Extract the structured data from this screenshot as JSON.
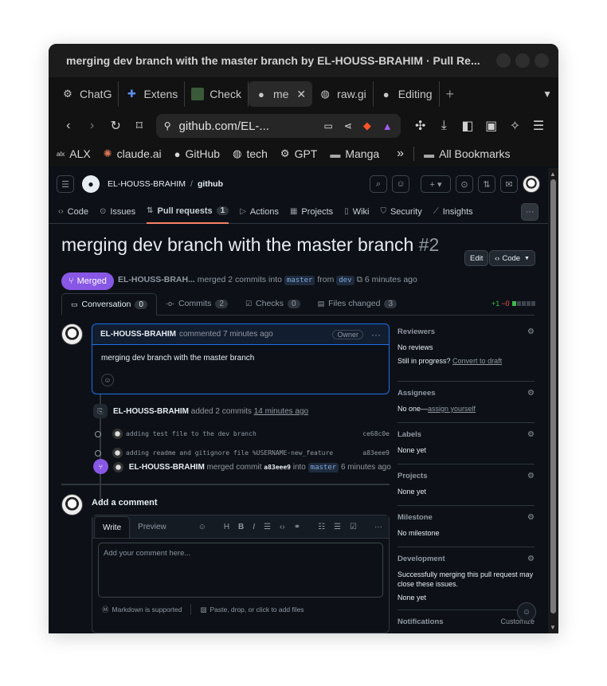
{
  "window": {
    "title": "merging dev branch with the master branch by EL-HOUSS-BRAHIM · Pull Re..."
  },
  "tabs": [
    {
      "label": "ChatG",
      "icon": "openai-icon"
    },
    {
      "label": "Extens",
      "icon": "puzzle-icon"
    },
    {
      "label": "Check",
      "icon": "image-icon"
    },
    {
      "label": "me",
      "icon": "github-icon",
      "active": true
    },
    {
      "label": "raw.gi",
      "icon": "globe-icon"
    },
    {
      "label": "Editing",
      "icon": "github-icon"
    }
  ],
  "address_bar": {
    "url": "github.com/EL-..."
  },
  "bookmarks": [
    {
      "label": "ALX",
      "icon": "alx-icon"
    },
    {
      "label": "claude.ai",
      "icon": "claude-icon"
    },
    {
      "label": "GitHub",
      "icon": "github-icon"
    },
    {
      "label": "tech",
      "icon": "globe-icon"
    },
    {
      "label": "GPT",
      "icon": "openai-icon"
    },
    {
      "label": "Manga",
      "icon": "folder-icon"
    }
  ],
  "bookmarks_more": "»",
  "all_bookmarks": "All Bookmarks",
  "repo": {
    "owner": "EL-HOUSS-BRAHIM",
    "separator": "/",
    "name": "github"
  },
  "repo_nav": [
    {
      "label": "Code"
    },
    {
      "label": "Issues"
    },
    {
      "label": "Pull requests",
      "count": "1",
      "active": true
    },
    {
      "label": "Actions"
    },
    {
      "label": "Projects"
    },
    {
      "label": "Wiki"
    },
    {
      "label": "Security"
    },
    {
      "label": "Insights"
    }
  ],
  "pr": {
    "title": "merging dev branch with the master branch",
    "number": "#2",
    "edit_label": "Edit",
    "code_label": "Code",
    "status": "Merged",
    "author": "EL-HOUSS-BRAH...",
    "meta_text": "merged 2 commits into",
    "base": "master",
    "from_text": "from",
    "head": "dev",
    "time": "6 minutes ago"
  },
  "pr_tabs": [
    {
      "label": "Conversation",
      "count": "0",
      "active": true
    },
    {
      "label": "Commits",
      "count": "2"
    },
    {
      "label": "Checks",
      "count": "0"
    },
    {
      "label": "Files changed",
      "count": "3"
    }
  ],
  "diffstat": {
    "additions": "+1",
    "deletions": "−0"
  },
  "comment": {
    "author": "EL-HOUSS-BRAHIM",
    "action": "commented 7 minutes ago",
    "role": "Owner",
    "body": "merging dev branch with the master branch"
  },
  "events": {
    "commits_event": {
      "author": "EL-HOUSS-BRAHIM",
      "text": "added 2 commits",
      "time": "14 minutes ago"
    },
    "commits": [
      {
        "message": "adding test file to the dev branch",
        "sha": "ce68c0e"
      },
      {
        "message": "adding readme and gitignore file %USERNAME-new_feature",
        "sha": "a83eee9"
      }
    ],
    "merge_event": {
      "author": "EL-HOUSS-BRAHIM",
      "text": "merged commit",
      "sha": "a83eee9",
      "into": "into",
      "branch": "master",
      "time": "6 minutes ago"
    }
  },
  "add_comment": {
    "title": "Add a comment",
    "write_tab": "Write",
    "preview_tab": "Preview",
    "placeholder": "Add your comment here...",
    "markdown_note": "Markdown is supported",
    "attach_note": "Paste, drop, or click to add files"
  },
  "sidebar": {
    "reviewers": {
      "title": "Reviewers",
      "value": "No reviews",
      "note": "Still in progress?",
      "link": "Convert to draft"
    },
    "assignees": {
      "title": "Assignees",
      "value": "No one—",
      "link": "assign yourself"
    },
    "labels": {
      "title": "Labels",
      "value": "None yet"
    },
    "projects": {
      "title": "Projects",
      "value": "None yet"
    },
    "milestone": {
      "title": "Milestone",
      "value": "No milestone"
    },
    "development": {
      "title": "Development",
      "value": "Successfully merging this pull request may close these issues.",
      "value2": "None yet"
    },
    "notifications": {
      "title": "Notifications",
      "action": "Customize"
    }
  }
}
